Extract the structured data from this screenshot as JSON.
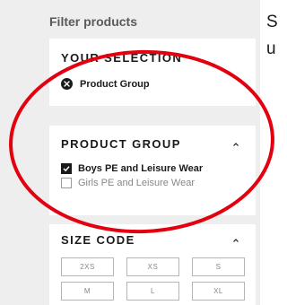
{
  "filter_title": "Filter products",
  "your_selection": {
    "heading": "YOUR SELECTION",
    "chip_label": "Product Group"
  },
  "product_group": {
    "heading": "PRODUCT GROUP",
    "options": [
      {
        "label": "Boys PE and Leisure Wear",
        "checked": true
      },
      {
        "label": "Girls PE and Leisure Wear",
        "checked": false
      }
    ]
  },
  "size_code": {
    "heading": "SIZE CODE",
    "sizes": [
      "2XS",
      "XS",
      "S",
      "M",
      "L",
      "XL"
    ]
  },
  "side_text": {
    "line1": "S",
    "line2": "u"
  },
  "icons": {
    "remove": "close-circle-icon",
    "collapse": "chevron-up-icon",
    "check": "check-icon"
  },
  "colors": {
    "panel_bg": "#eeeeee",
    "card_bg": "#ffffff",
    "text": "#1a1a1a",
    "muted": "#888888",
    "annotation": "#e3000f"
  }
}
